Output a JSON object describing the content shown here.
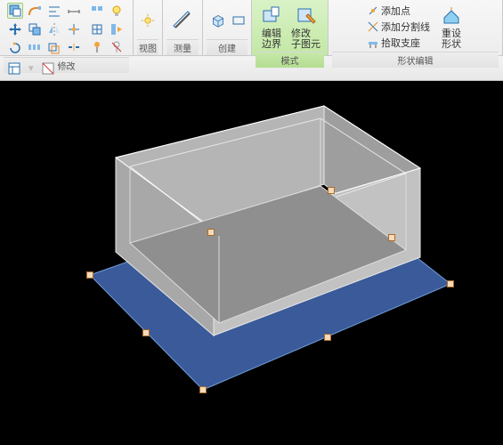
{
  "ribbon": {
    "panels": {
      "modify": {
        "label": "修改"
      },
      "view": {
        "label": "视图"
      },
      "measure": {
        "label": "测量"
      },
      "create": {
        "label": "创建"
      },
      "mode": {
        "label": "模式",
        "edit_boundary": "编辑\n边界",
        "modify_sub": "修改\n子图元"
      },
      "shape_edit": {
        "label": "形状编辑",
        "add_point": "添加点",
        "add_split_line": "添加分割线",
        "pick_supports": "拾取支座",
        "reset_shape": "重设\n形状"
      }
    }
  },
  "colors": {
    "accent": "#5a7fb0",
    "floor_fill": "#3a5a99",
    "wall_fill": "#b7b7b7",
    "wall_edge": "#e5e5e5"
  }
}
